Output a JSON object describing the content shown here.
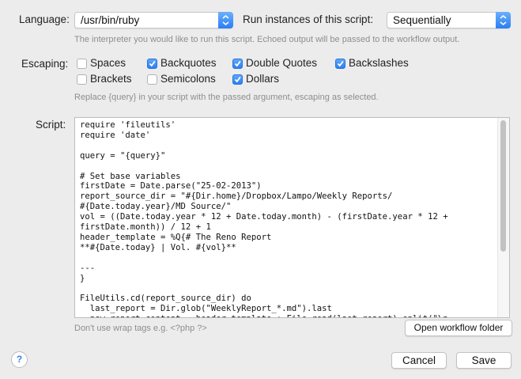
{
  "language": {
    "label": "Language:",
    "value": "/usr/bin/ruby"
  },
  "run": {
    "label": "Run instances of this script:",
    "value": "Sequentially"
  },
  "interpreter_hint": "The interpreter you would like to run this script. Echoed output will be passed to the workflow output.",
  "escaping": {
    "label": "Escaping:",
    "options": [
      {
        "label": "Spaces",
        "checked": false
      },
      {
        "label": "Backquotes",
        "checked": true
      },
      {
        "label": "Double Quotes",
        "checked": true
      },
      {
        "label": "Backslashes",
        "checked": true
      },
      {
        "label": "Brackets",
        "checked": false
      },
      {
        "label": "Semicolons",
        "checked": false
      },
      {
        "label": "Dollars",
        "checked": true
      }
    ],
    "hint": "Replace {query} in your script with the passed argument, escaping as selected."
  },
  "script": {
    "label": "Script:",
    "code": "require 'fileutils'\nrequire 'date'\n\nquery = \"{query}\"\n\n# Set base variables\nfirstDate = Date.parse(\"25-02-2013\")\nreport_source_dir = \"#{Dir.home}/Dropbox/Lampo/Weekly Reports/\n#{Date.today.year}/MD Source/\"\nvol = ((Date.today.year * 12 + Date.today.month) - (firstDate.year * 12 +\nfirstDate.month)) / 12 + 1\nheader_template = %Q{# The Reno Report\n**#{Date.today} | Vol. #{vol}**\n\n---\n}\n\nFileUtils.cd(report_source_dir) do\n  last_report = Dir.glob(\"WeeklyReport_*.md\").last\n  new_report_content = header_template + File.read(last_report).split(\"\\n"
  },
  "wrap_hint": "Don't use wrap tags e.g. <?php ?>",
  "buttons": {
    "open_folder": "Open workflow folder",
    "help": "?",
    "cancel": "Cancel",
    "save": "Save"
  },
  "colors": {
    "accent": "#2c7ff2",
    "window": "#ececec"
  }
}
